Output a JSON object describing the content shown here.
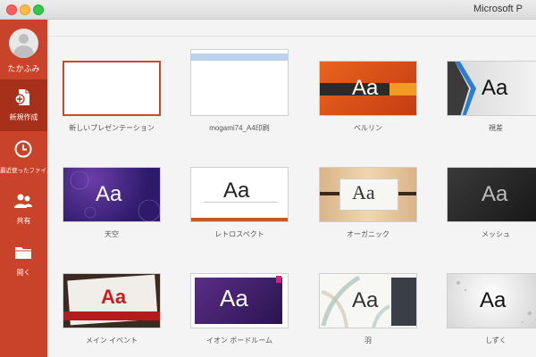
{
  "window": {
    "title": "Microsoft P"
  },
  "user": {
    "name": "たかふみ"
  },
  "sidebar": {
    "items": [
      {
        "label": "新規作成",
        "icon": "new-document-icon"
      },
      {
        "label": "最近使ったファイル",
        "icon": "clock-icon"
      },
      {
        "label": "共有",
        "icon": "people-icon"
      },
      {
        "label": "開く",
        "icon": "folder-icon"
      }
    ]
  },
  "templates": [
    {
      "name": "新しいプレゼンテーション"
    },
    {
      "name": "mogami74_A4印刷"
    },
    {
      "name": "ベルリン",
      "sample": "Aa"
    },
    {
      "name": "視差",
      "sample": "Aa"
    },
    {
      "name": "天空",
      "sample": "Aa"
    },
    {
      "name": "レトロスペクト",
      "sample": "Aa"
    },
    {
      "name": "オーガニック",
      "sample": "Aa"
    },
    {
      "name": "メッシュ",
      "sample": "Aa"
    },
    {
      "name": "メイン イベント",
      "sample": "Aa"
    },
    {
      "name": "イオン ボードルーム",
      "sample": "Aa"
    },
    {
      "name": "羽",
      "sample": "Aa"
    },
    {
      "name": "しずく",
      "sample": "Aa"
    }
  ],
  "colors": {
    "sidebar": "#c9432a",
    "sidebar_active": "#a7301b",
    "selection": "#d24726"
  }
}
